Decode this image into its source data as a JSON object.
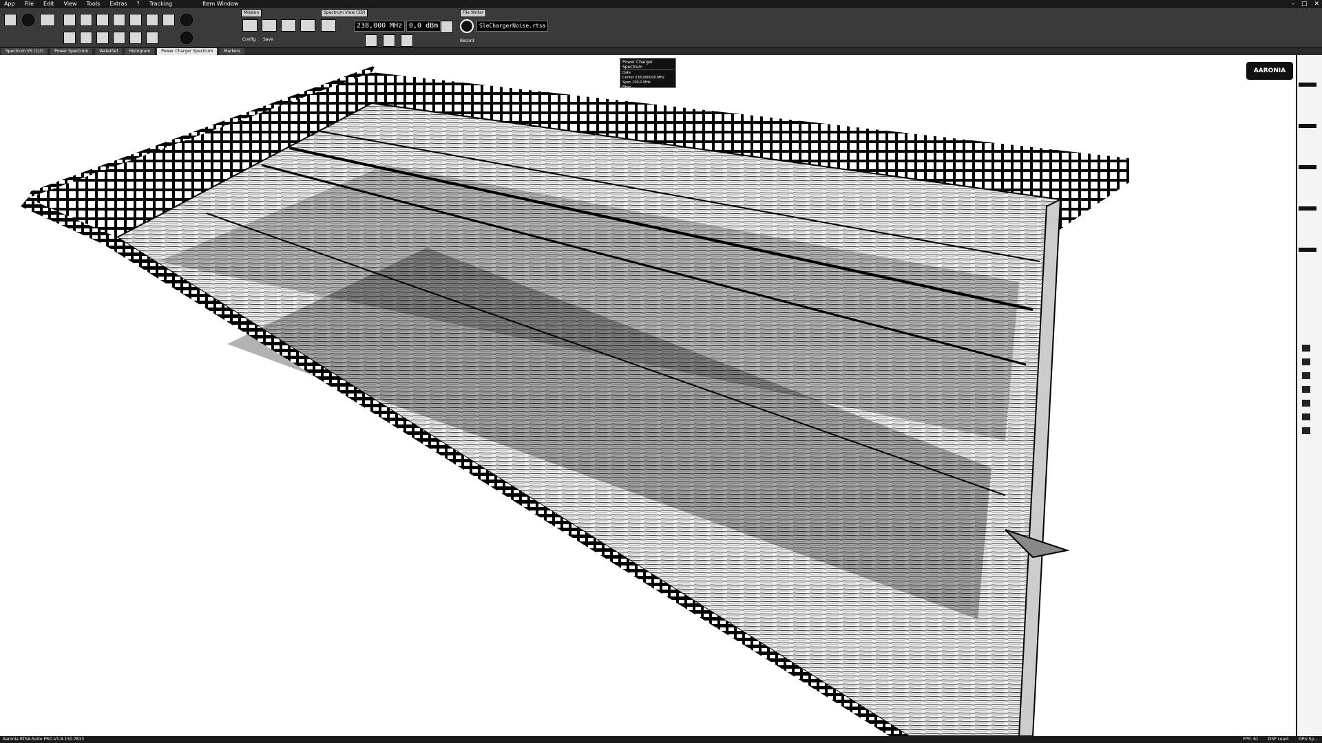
{
  "menubar": {
    "items": [
      "App",
      "File",
      "Edit",
      "View",
      "Tools",
      "Extras",
      "?",
      "Tracking"
    ],
    "title": "Item Window"
  },
  "ribbon": {
    "groups": {
      "mission": "Mission",
      "spectrum_view": "Spectrum View (3D)",
      "file_writer": "File Writer"
    },
    "center_frequency": "238,000 MHz",
    "reference_level": "0,0 dBm",
    "file_name": "SleChargerNoise.rtsa",
    "labels": [
      "Config",
      "Save",
      "Record"
    ]
  },
  "tabs": [
    "Spectrum VS (1/1)",
    "Power Spectrum",
    "Waterfall",
    "Histogram",
    "Power Charger Spectrum",
    "Markers"
  ],
  "active_tab": "Power Charger Spectrum",
  "infobox": {
    "title": "Power Charger Spectrum",
    "rows": [
      "Date",
      "Center  238,000000 MHz",
      "Span    100,0 MHz",
      "Filter  ..."
    ]
  },
  "logo_text": "AARONIA",
  "status": {
    "app_version": "Aaronia RTSA-Suite PRO V1.8.150.7813",
    "fps": "FPS: 61",
    "dsp_load": "DSP Load:",
    "gpu": "GPU Sp..."
  },
  "colors": {
    "background": "#ffffff",
    "chrome": "#1a1a1a",
    "ribbon": "#3a3a3a"
  }
}
